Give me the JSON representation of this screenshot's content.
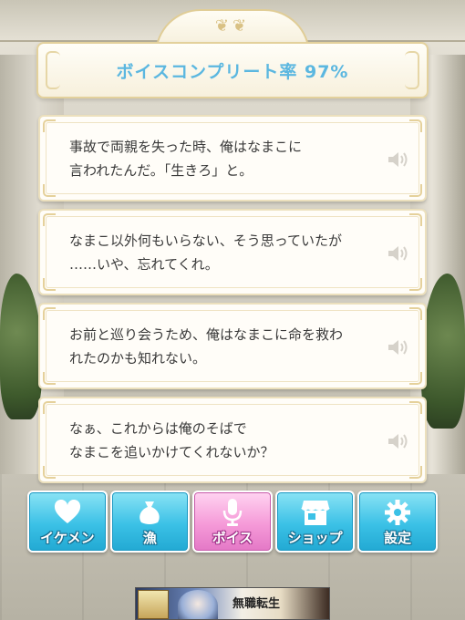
{
  "header": {
    "title": "ボイスコンプリート率 97%"
  },
  "voices": [
    {
      "line1": "事故で両親を失った時、俺はなまこに",
      "line2": "言われたんだ。「生きろ」と。",
      "icon": "speaker-icon"
    },
    {
      "line1": "なまこ以外何もいらない、そう思っていたが",
      "line2": "……いや、忘れてくれ。",
      "icon": "speaker-icon"
    },
    {
      "line1": "お前と巡り会うため、俺はなまこに命を救わ",
      "line2": "れたのかも知れない。",
      "icon": "speaker-icon"
    },
    {
      "line1": "なぁ、これからは俺のそばで",
      "line2": "なまこを追いかけてくれないか？",
      "icon": "speaker-icon"
    }
  ],
  "nav": [
    {
      "label": "イケメン",
      "icon": "heart-icon",
      "active": false
    },
    {
      "label": "漁",
      "icon": "sack-icon",
      "active": false
    },
    {
      "label": "ボイス",
      "icon": "microphone-icon",
      "active": true
    },
    {
      "label": "ショップ",
      "icon": "shop-icon",
      "active": false
    },
    {
      "label": "設定",
      "icon": "gear-icon",
      "active": false
    }
  ],
  "ad": {
    "text": "無職転生"
  },
  "colors": {
    "title": "#5bb7e0",
    "nav_default": "#3bc1e6",
    "nav_active": "#f59ad8",
    "card_border": "#ece0bd"
  }
}
